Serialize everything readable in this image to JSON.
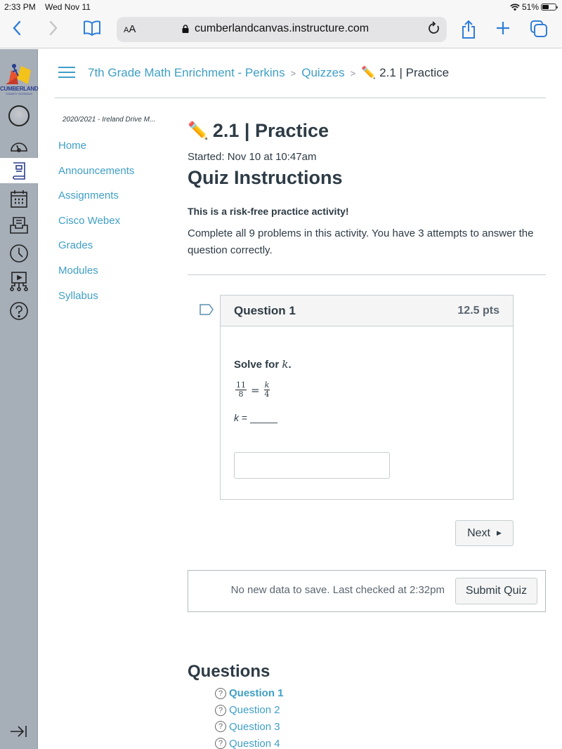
{
  "status_bar": {
    "time": "2:33 PM",
    "date": "Wed Nov 11",
    "battery": "51%",
    "battery_level": 0.51
  },
  "browser": {
    "text_size_label": "AA",
    "url": "cumberlandcanvas.instructure.com",
    "icons": [
      "back-icon",
      "forward-icon",
      "bookmarks-icon",
      "lock-icon",
      "reload-icon",
      "share-icon",
      "new-tab-icon",
      "tabs-icon"
    ]
  },
  "global_nav": {
    "logo": {
      "name": "CUMBERLAND",
      "sub": "COUNTY SCHOOLS"
    },
    "items": [
      {
        "icon": "account-icon",
        "label": "Account"
      },
      {
        "icon": "dashboard-icon",
        "label": "Dashboard"
      },
      {
        "icon": "courses-icon",
        "label": "Courses",
        "active": true
      },
      {
        "icon": "calendar-icon",
        "label": "Calendar"
      },
      {
        "icon": "inbox-icon",
        "label": "Inbox"
      },
      {
        "icon": "history-icon",
        "label": "History"
      },
      {
        "icon": "studio-icon",
        "label": "Studio"
      },
      {
        "icon": "help-icon",
        "label": "Help"
      }
    ],
    "collapse_icon": "collapse-icon"
  },
  "breadcrumb": {
    "course": "7th Grade Math Enrichment - Perkins",
    "section": "Quizzes",
    "current": "2.1 | Practice"
  },
  "course_nav": {
    "term": "2020/2021 - Ireland Drive M...",
    "items": [
      "Home",
      "Announcements",
      "Assignments",
      "Cisco Webex",
      "Grades",
      "Modules",
      "Syllabus"
    ]
  },
  "quiz": {
    "title": "2.1 | Practice",
    "title_emoji": "✏️",
    "started": "Started: Nov 10 at 10:47am",
    "instructions_title": "Quiz Instructions",
    "risk_free": "This is a risk-free practice activity!",
    "description": "Complete all 9 problems in this activity. You have 3 attempts to answer the question correctly."
  },
  "question": {
    "name": "Question 1",
    "points": "12.5 pts",
    "prompt": "Solve for ",
    "prompt_var": "k",
    "prompt_end": ".",
    "equation": {
      "left_num": "11",
      "left_den": "8",
      "equals": "=",
      "right_num": "k",
      "right_den": "4"
    },
    "answer_prompt_var": "k",
    "answer_prompt": " = _____",
    "answer_value": ""
  },
  "buttons": {
    "next": "Next",
    "submit": "Submit Quiz"
  },
  "save_status": "No new data to save. Last checked at 2:32pm",
  "questions_list": {
    "title": "Questions",
    "items": [
      {
        "label": "Question 1",
        "current": true
      },
      {
        "label": "Question 2"
      },
      {
        "label": "Question 3"
      },
      {
        "label": "Question 4"
      }
    ]
  }
}
